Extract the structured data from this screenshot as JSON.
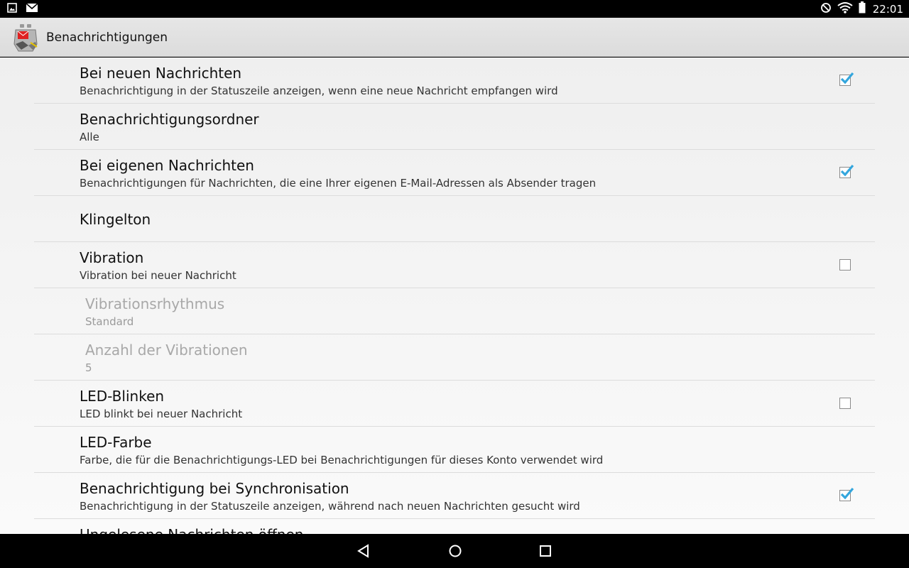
{
  "status_bar": {
    "time": "22:01",
    "icons_left": [
      "image-notification-icon",
      "mail-notification-icon"
    ],
    "icons_right": [
      "do-not-disturb-icon",
      "wifi-icon",
      "battery-icon"
    ]
  },
  "action_bar": {
    "title": "Benachrichtigungen",
    "app_icon": "k9-mail-app-icon"
  },
  "preferences": [
    {
      "title": "Bei neuen Nachrichten",
      "summary": "Benachrichtigung in der Statuszeile anzeigen, wenn eine neue Nachricht empfangen wird",
      "checkbox": true,
      "checked": true,
      "enabled": true
    },
    {
      "title": "Benachrichtigungsordner",
      "summary": "Alle",
      "checkbox": false,
      "enabled": true
    },
    {
      "title": "Bei eigenen Nachrichten",
      "summary": "Benachrichtigungen für Nachrichten, die eine Ihrer eigenen E-Mail-Adressen als Absender tragen",
      "checkbox": true,
      "checked": true,
      "enabled": true
    },
    {
      "title": "Klingelton",
      "summary": "",
      "checkbox": false,
      "enabled": true
    },
    {
      "title": "Vibration",
      "summary": "Vibration bei neuer Nachricht",
      "checkbox": true,
      "checked": false,
      "enabled": true
    },
    {
      "title": "Vibrationsrhythmus",
      "summary": "Standard",
      "checkbox": false,
      "enabled": false
    },
    {
      "title": "Anzahl der Vibrationen",
      "summary": "5",
      "checkbox": false,
      "enabled": false
    },
    {
      "title": "LED-Blinken",
      "summary": "LED blinkt bei neuer Nachricht",
      "checkbox": true,
      "checked": false,
      "enabled": true
    },
    {
      "title": "LED-Farbe",
      "summary": "Farbe, die für die Benachrichtigungs-LED bei Benachrichtigungen für dieses Konto verwendet wird",
      "checkbox": false,
      "enabled": true
    },
    {
      "title": "Benachrichtigung bei Synchronisation",
      "summary": "Benachrichtigung in der Statuszeile anzeigen, während nach neuen Nachrichten gesucht wird",
      "checkbox": true,
      "checked": true,
      "enabled": true
    },
    {
      "title": "Ungelesene Nachrichten öffnen",
      "summary": "",
      "checkbox": false,
      "enabled": true
    }
  ],
  "nav_bar": {
    "icons": [
      "back-icon",
      "home-icon",
      "recents-icon"
    ]
  },
  "colors": {
    "accent": "#33a6dd",
    "disabled_text": "#a8a8a8"
  }
}
